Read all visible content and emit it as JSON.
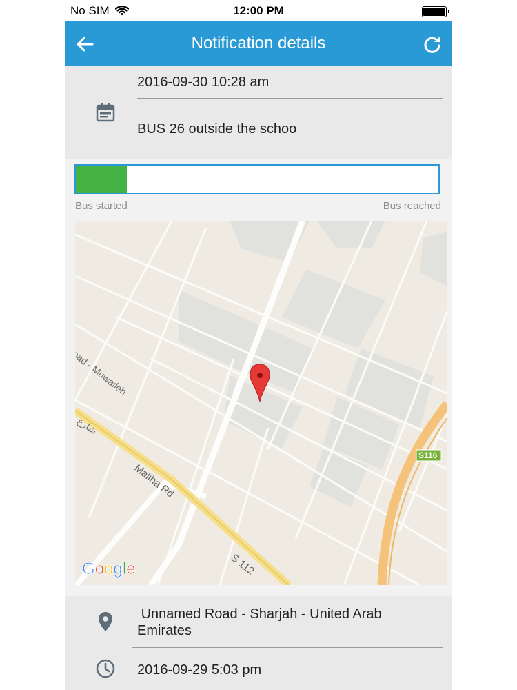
{
  "status_bar": {
    "carrier": "No SIM",
    "time": "12:00 PM"
  },
  "appbar": {
    "title": "Notification details",
    "back_icon": "arrow-left-icon",
    "refresh_icon": "refresh-icon"
  },
  "notification": {
    "date": "2016-09-30 10:28 am",
    "message": "BUS 26 outside the schoo",
    "icon": "calendar-icon"
  },
  "progress": {
    "value_fraction": 0.14,
    "start_label": "Bus started",
    "end_label": "Bus reached",
    "fill_color": "#44b244",
    "border_color": "#2a9ad6"
  },
  "map": {
    "labels": {
      "road_1": "oad - Muwaileh",
      "road_2": "Maliha Rd",
      "road_3": "S 112",
      "arabic": "شارع",
      "shield": "S116"
    },
    "logo": "Google"
  },
  "location": {
    "address": " Unnamed Road - Sharjah - United Arab\nEmirates",
    "time": "2016-09-29 5:03 pm",
    "pin_icon": "location-pin-icon",
    "clock_icon": "clock-icon"
  },
  "colors": {
    "accent": "#2a9ad6",
    "icon_gray": "#5f6d78"
  }
}
